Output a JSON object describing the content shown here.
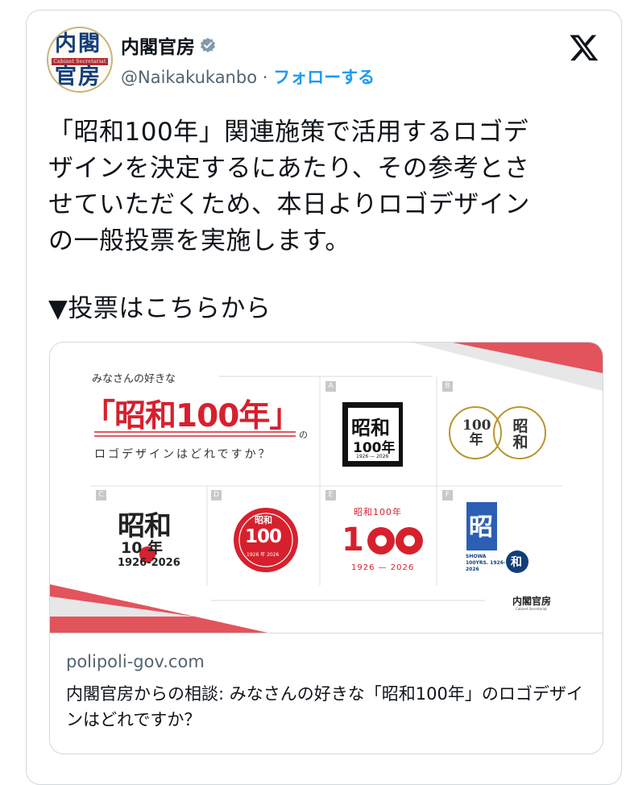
{
  "author": {
    "name": "内閣官房",
    "handle": "@Naikakukanbo",
    "separator": " · ",
    "follow_label": "フォローする",
    "avatar_text": "内閣官房 Cabinet Secretariat"
  },
  "tweet": {
    "text": "「昭和100年」関連施策で活用するロゴデ\nザインを決定するにあたり、その参考とさ\nせていただくため、本日よりロゴデザイン\nの一般投票を実施します。",
    "vote_line": "▼投票はこちらから"
  },
  "card": {
    "domain": "polipoli-gov.com",
    "title": "内閣官房からの相談: みなさんの好きな「昭和100年」のロゴデザインはどれですか？",
    "image": {
      "kicker": "みなさんの好きな",
      "headline": "「昭和100年」",
      "headline_suffix": "の",
      "subhead": "ロゴデザインはどれですか？",
      "brand": "内閣官房",
      "brand_sub": "Cabinet Secretariat",
      "options": [
        {
          "tag": "A",
          "line1": "昭和",
          "line2": "100年",
          "line3": "1926 — 2026"
        },
        {
          "tag": "B",
          "line1": "100年",
          "line2": "昭和"
        },
        {
          "tag": "C",
          "line1": "昭和",
          "line2": "10 年",
          "line3": "1926-2026"
        },
        {
          "tag": "D",
          "line1": "昭和",
          "line2": "100",
          "line3": "1926 年 2026"
        },
        {
          "tag": "E",
          "line1": "昭和100年",
          "line2": "1",
          "line3": "1926 — 2026"
        },
        {
          "tag": "F",
          "line1": "昭",
          "line2": "SHOWA 100YRS. 1926-2026",
          "line3": "和"
        }
      ]
    }
  },
  "colors": {
    "accent": "#1d9bf0",
    "red": "#d7202d",
    "navy": "#123e7a"
  }
}
